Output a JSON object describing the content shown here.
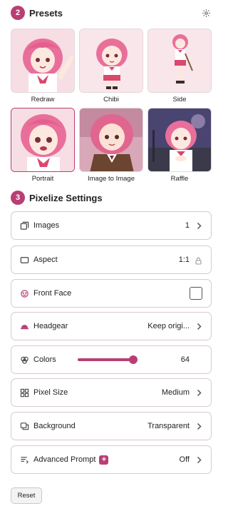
{
  "presets": {
    "step": "2",
    "title": "Presets",
    "items": [
      {
        "label": "Redraw"
      },
      {
        "label": "Chibi"
      },
      {
        "label": "Side"
      },
      {
        "label": "Portrait",
        "selected": true
      },
      {
        "label": "Image to Image"
      },
      {
        "label": "Raffle"
      }
    ]
  },
  "settings": {
    "step": "3",
    "title": "Pixelize Settings",
    "rows": {
      "images": {
        "label": "Images",
        "value": "1"
      },
      "aspect": {
        "label": "Aspect",
        "value": "1:1"
      },
      "front_face": {
        "label": "Front Face",
        "checked": false
      },
      "headgear": {
        "label": "Headgear",
        "value": "Keep origi..."
      },
      "colors": {
        "label": "Colors",
        "value": "64",
        "slider_fraction": 1.0
      },
      "pixel_size": {
        "label": "Pixel Size",
        "value": "Medium"
      },
      "background": {
        "label": "Background",
        "value": "Transparent"
      },
      "advanced_prompt": {
        "label": "Advanced Prompt",
        "badge": "+",
        "value": "Off"
      }
    }
  },
  "reset_label": "Reset",
  "colors": {
    "accent": "#b83f74",
    "border": "#d9c9d0"
  },
  "icons": [
    "gear-icon",
    "images-icon",
    "aspect-icon",
    "face-icon",
    "headgear-icon",
    "palette-icon",
    "grid-icon",
    "background-icon",
    "prompt-icon",
    "lock-icon",
    "chevron-right-icon"
  ]
}
